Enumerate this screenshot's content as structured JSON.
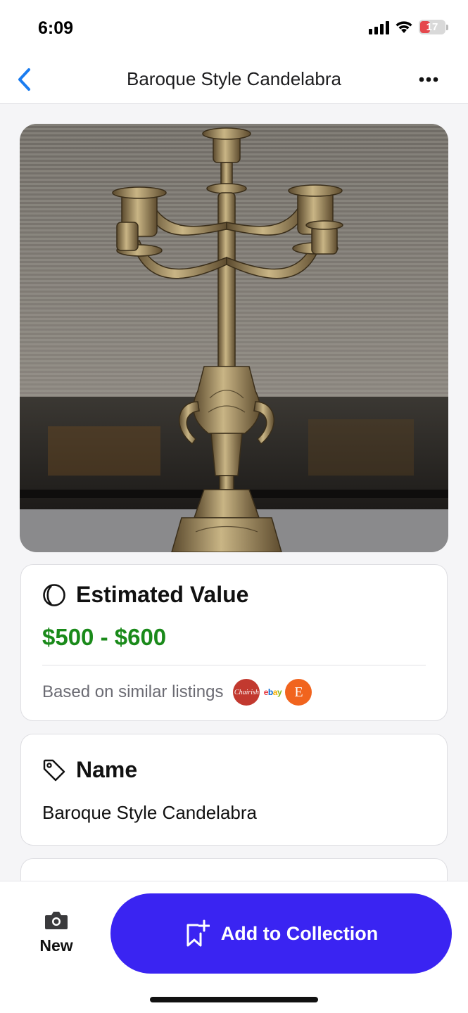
{
  "status_bar": {
    "time": "6:09",
    "battery_level": "17",
    "battery_fraction": 0.17,
    "icons": [
      "signal-icon",
      "wifi-icon",
      "battery-icon"
    ]
  },
  "nav": {
    "title": "Baroque Style Candelabra",
    "back_icon": "chevron-left-icon",
    "more_icon": "ellipsis-icon",
    "accent_color": "#1a7cf0"
  },
  "photo": {
    "subject": "brass candelabra photo"
  },
  "estimated_value": {
    "heading": "Estimated Value",
    "range": "$500 - $600",
    "range_color": "#1a8a1a",
    "source_text": "Based on similar listings",
    "sources": [
      {
        "name": "Chairish",
        "glyph": "Chairish"
      },
      {
        "name": "eBay",
        "glyph": "ebay"
      },
      {
        "name": "Etsy",
        "glyph": "E"
      }
    ]
  },
  "name_card": {
    "heading": "Name",
    "value": "Baroque Style Candelabra"
  },
  "bottom_bar": {
    "new_label": "New",
    "add_label": "Add to Collection",
    "button_color": "#3a24f2"
  }
}
